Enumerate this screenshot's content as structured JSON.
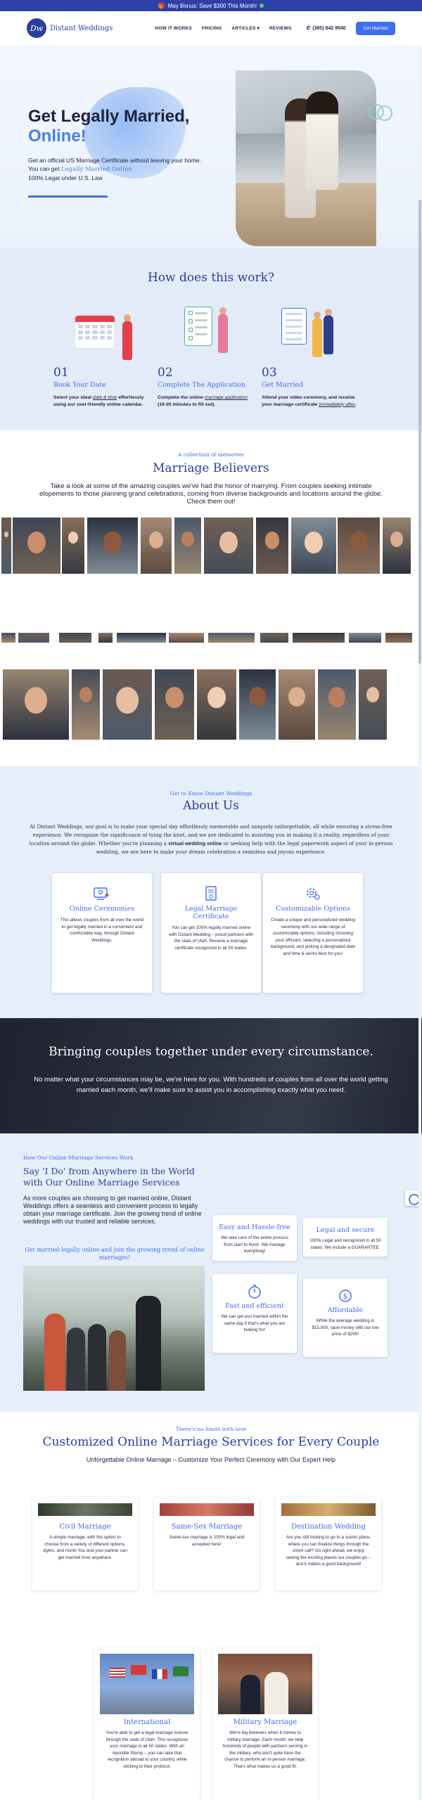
{
  "promo": {
    "text": "May Bonus: Save $300 This Month!"
  },
  "header": {
    "logo_text": "Distant Weddings",
    "logo_mark": "Dw",
    "nav": [
      "HOW IT WORKS",
      "PRICING",
      "ARTICLES",
      "REVIEWS"
    ],
    "phone": "(385) 842 9540",
    "cta": "Get Married"
  },
  "hero": {
    "title_line1": "Get Legally Married,",
    "title_line2": "Online!",
    "sub_part1": "Get an official US Marriage Certificate without leaving your home. You can get ",
    "sub_link": "Legally Married Online",
    "sub_part2": "100% Legal under U.S. Law"
  },
  "how": {
    "title": "How does this work?",
    "steps": [
      {
        "num": "01",
        "title": "Book Your Date",
        "desc_a": "Select your ideal ",
        "desc_link": "date & time",
        "desc_b": " effortlessly using our user-friendly online calendar."
      },
      {
        "num": "02",
        "title": "Complete The Application",
        "desc_a": "Complete the online ",
        "desc_link": "marriage application",
        "desc_b": " (10-20 minutes to fill out)."
      },
      {
        "num": "03",
        "title": "Get Married",
        "desc_a": "Attend your video ceremony, and receive your marriage certificate ",
        "desc_link": "immediately after",
        "desc_b": "."
      }
    ]
  },
  "believers": {
    "kicker": "A collection of memories",
    "title": "Marriage Believers",
    "text": "Take a look at some of the amazing couples we've had the honor of marrying. From couples seeking intimate elopements to those planning grand celebrations, coming from diverse backgrounds and locations around the globe. Check them out!"
  },
  "about": {
    "kicker": "Get to Know Distant Weddings",
    "title": "About Us",
    "body_a": "At Distant Weddings, our goal is to make your special day effortlessly memorable and uniquely unforgettable, all while ensuring a stress-free experience. We recognize the significance of tying the knot, and we are dedicated to assisting you in making it a reality, regardless of your location around the globe. Whether you're planning a ",
    "body_bold": "virtual wedding online",
    "body_b": " or seeking help with the legal paperwork aspect of your in-person wedding, we are here to make your dream celebration a seamless and joyous experience.",
    "cards": [
      {
        "title": "Online Ceremonies",
        "desc": "This allows couples from all over the world to get legally married in a convenient and comfortable way, through Distant Weddings."
      },
      {
        "title": "Legal Marriage Certificate",
        "desc": "You can get 100% legally married online with Distant Wedding – proud partners with the state of Utah. Receive a marriage certificate recognized in all 50 states."
      },
      {
        "title": "Customizable Options",
        "desc": "Create a unique and personalized wedding ceremony with our wide range of customizable options, including choosing your officiant, selecting a personalized background, and picking a designated date and time & works best for you!"
      }
    ]
  },
  "banner": {
    "title": "Bringing couples together under every circumstance.",
    "text": "No matter what your circumstances may be, we're here for you. With hundreds of couples from all over the world getting married each month, we'll make sure to assist you in accomplishing exactly what you need."
  },
  "services": {
    "kicker": "How Our Online Marriage Services Work",
    "title": "Say 'I Do' from Anywhere in the World with Our Online Marriage Services",
    "intro": "As more couples are choosing to get married online, Distant Weddings offers a seamless and convenient process to legally obtain your marriage certificate. Join the growing trend of online weddings with our trusted and reliable services.",
    "cta": "Get married legally online and join the growing trend of online marriages!",
    "cards": [
      {
        "title": "Easy and Hassle-free",
        "desc": "We take care of the entire process from start to finish. We manage everything!"
      },
      {
        "title": "Legal and secure",
        "desc": "100% Legal and recognized in all 50 states. We include a GUARANTEE."
      },
      {
        "title": "Fast and efficient",
        "desc": "We can get you married within the same day if that's what you are looking for!"
      },
      {
        "title": "Affordable",
        "desc": "While the average wedding is $15,000, save money with our low price of $299!"
      }
    ]
  },
  "custom": {
    "kicker": "There's no limits with love",
    "title": "Customized Online Marriage Services for Every Couple",
    "sub": "Unforgettable Online Marriage – Customize Your Perfect Ceremony with Our Expert Help",
    "cards": [
      {
        "title": "Civil Marriage",
        "desc": "A simple marriage, with the option to choose from a variety of different options, styles, and more! You and your partner can get married from anywhere."
      },
      {
        "title": "Same-Sex Marriage",
        "desc": "Same-sex marriage is 100% legal and accepted here!"
      },
      {
        "title": "Destination Wedding",
        "desc": "Are you still looking to go to a scenic place, where you can finalize things through the zoom call? Go right ahead, we enjoy seeing the exciting places our couples go – and it makes a good background!"
      },
      {
        "title": "International",
        "desc": "You're able to get a legal marriage license through the state of Utah. This recognizes your marriage in all 50 states. With an Apostille Stamp – you can take that recognition abroad to your country, while sticking to their protocol."
      },
      {
        "title": "Military Marriage",
        "desc": "We're big believers when it comes to military marriage. Each month, we help hundreds of people with partners serving in the military, who don't quite have the chance to perform an in-person marriage. That's what makes us a good fit."
      }
    ]
  },
  "colors": {
    "brand": "#2a3da0",
    "accent": "#3f6ef0",
    "promo_bg": "#2f3fa8",
    "section_bg": "#e6eef9"
  }
}
